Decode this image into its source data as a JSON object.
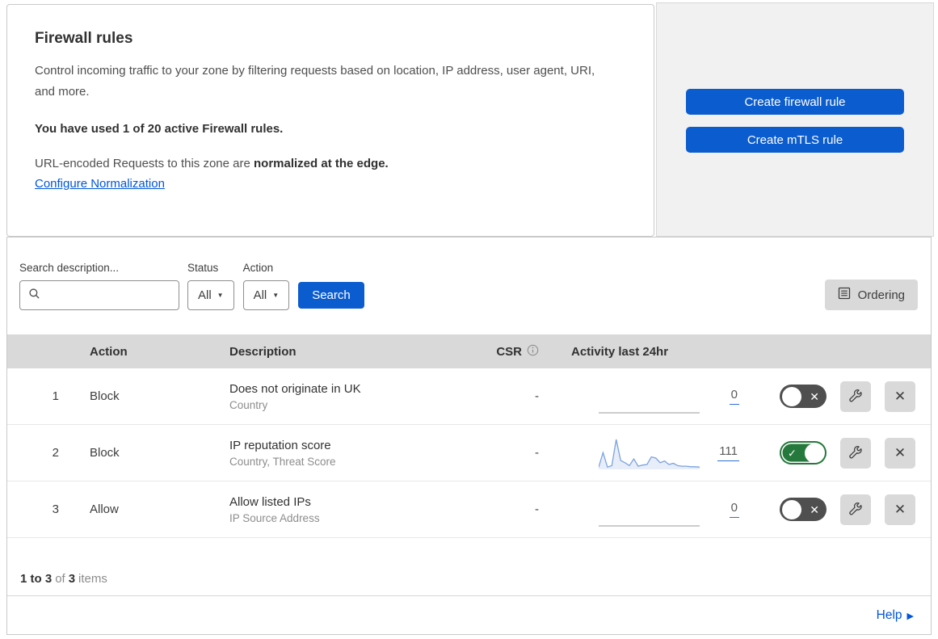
{
  "header": {
    "title": "Firewall rules",
    "description": "Control incoming traffic to your zone by filtering requests based on location, IP address, user agent, URI, and more.",
    "usage_line": "You have used 1 of 20 active Firewall rules.",
    "normalization_text": "URL-encoded Requests to this zone are ",
    "normalization_bold": "normalized at the edge.",
    "normalization_link": "Configure Normalization"
  },
  "actions_panel": {
    "create_firewall_label": "Create firewall rule",
    "create_mtls_label": "Create mTLS rule"
  },
  "filters": {
    "search_label": "Search description...",
    "status_label": "Status",
    "status_value": "All",
    "action_label": "Action",
    "action_value": "All",
    "search_button": "Search",
    "ordering_button": "Ordering"
  },
  "table": {
    "headers": {
      "action": "Action",
      "description": "Description",
      "csr": "CSR",
      "activity": "Activity last 24hr"
    },
    "rows": [
      {
        "number": "1",
        "action": "Block",
        "description": "Does not originate in UK",
        "criteria": "Country",
        "csr": "-",
        "count": "0",
        "enabled": false,
        "sparkline": []
      },
      {
        "number": "2",
        "action": "Block",
        "description": "IP reputation score",
        "criteria": "Country, Threat Score",
        "csr": "-",
        "count": "111",
        "enabled": true,
        "sparkline": [
          5,
          55,
          5,
          10,
          100,
          28,
          20,
          10,
          33,
          8,
          12,
          14,
          40,
          36,
          20,
          26,
          14,
          18,
          10,
          8,
          8,
          6,
          6,
          5
        ]
      },
      {
        "number": "3",
        "action": "Allow",
        "description": "Allow listed IPs",
        "criteria": "IP Source Address",
        "csr": "-",
        "count": "0",
        "enabled": false,
        "sparkline": []
      }
    ]
  },
  "footer": {
    "range_bold": "1 to 3",
    "of_text": "of",
    "total_bold": "3",
    "items_text": "items",
    "help_label": "Help"
  },
  "icons": {
    "search": "magnifier-icon",
    "info": "info-circle-icon",
    "ordering": "list-document-icon",
    "edit": "wrench-icon",
    "delete": "x-icon",
    "toggle_on": "check-glyph",
    "toggle_off": "x-glyph",
    "help": "right-arrow-icon"
  },
  "colors": {
    "accent_blue": "#0b5cce",
    "link_blue": "#0055dc",
    "toggle_on_green": "#26793c",
    "toggle_off_gray": "#4f4f4f",
    "panel_gray": "#f1f1f1",
    "table_header_gray": "#d9d9d9",
    "sparkline_blue": "#7ba2e0"
  }
}
